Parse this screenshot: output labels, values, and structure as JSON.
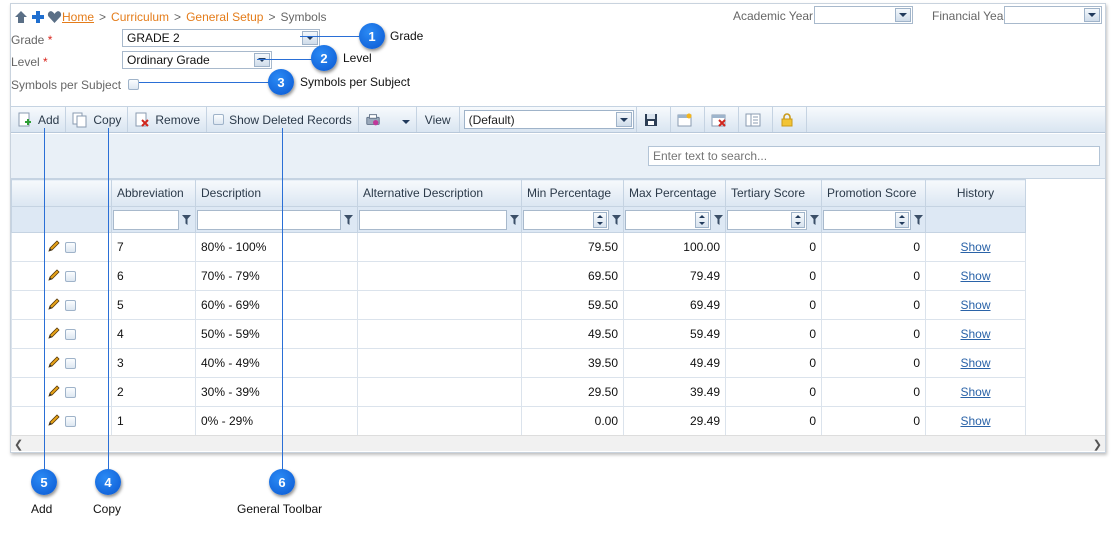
{
  "breadcrumb": {
    "home": "Home",
    "curriculum": "Curriculum",
    "general_setup": "General Setup",
    "current": "Symbols",
    "separator": ">"
  },
  "header": {
    "academic_year_label": "Academic Year",
    "financial_year_label": "Financial Year",
    "academic_year_value": "",
    "financial_year_value": ""
  },
  "form": {
    "grade_label": "Grade",
    "grade_value": "GRADE 2",
    "level_label": "Level",
    "level_value": "Ordinary Grade",
    "symbols_per_subject_label": "Symbols per Subject",
    "required_marker": "*"
  },
  "toolbar": {
    "add": "Add",
    "copy": "Copy",
    "remove": "Remove",
    "show_deleted": "Show Deleted Records",
    "view_label": "View",
    "view_value": "(Default)"
  },
  "search": {
    "placeholder": "Enter text to search..."
  },
  "grid": {
    "columns": [
      "Abbreviation",
      "Description",
      "Alternative Description",
      "Min Percentage",
      "Max Percentage",
      "Tertiary Score",
      "Promotion Score",
      "History"
    ],
    "rows": [
      {
        "abbreviation": "7",
        "description": "80% - 100%",
        "alt": "",
        "min": "79.50",
        "max": "100.00",
        "tertiary": "0",
        "promotion": "0",
        "history": "Show"
      },
      {
        "abbreviation": "6",
        "description": "70% - 79%",
        "alt": "",
        "min": "69.50",
        "max": "79.49",
        "tertiary": "0",
        "promotion": "0",
        "history": "Show"
      },
      {
        "abbreviation": "5",
        "description": "60% - 69%",
        "alt": "",
        "min": "59.50",
        "max": "69.49",
        "tertiary": "0",
        "promotion": "0",
        "history": "Show"
      },
      {
        "abbreviation": "4",
        "description": "50% - 59%",
        "alt": "",
        "min": "49.50",
        "max": "59.49",
        "tertiary": "0",
        "promotion": "0",
        "history": "Show"
      },
      {
        "abbreviation": "3",
        "description": "40% - 49%",
        "alt": "",
        "min": "39.50",
        "max": "49.49",
        "tertiary": "0",
        "promotion": "0",
        "history": "Show"
      },
      {
        "abbreviation": "2",
        "description": "30% - 39%",
        "alt": "",
        "min": "29.50",
        "max": "39.49",
        "tertiary": "0",
        "promotion": "0",
        "history": "Show"
      },
      {
        "abbreviation": "1",
        "description": "0% - 29%",
        "alt": "",
        "min": "0.00",
        "max": "29.49",
        "tertiary": "0",
        "promotion": "0",
        "history": "Show"
      }
    ]
  },
  "callouts": {
    "c1": {
      "num": "1",
      "label": "Grade"
    },
    "c2": {
      "num": "2",
      "label": "Level"
    },
    "c3": {
      "num": "3",
      "label": "Symbols per Subject"
    },
    "c4": {
      "num": "4",
      "label": "Copy"
    },
    "c5": {
      "num": "5",
      "label": "Add"
    },
    "c6": {
      "num": "6",
      "label": "General Toolbar"
    }
  },
  "colors": {
    "accent": "#0a57d1",
    "link": "#e47c1a",
    "toolbar_bg": "#d9e5f1"
  }
}
